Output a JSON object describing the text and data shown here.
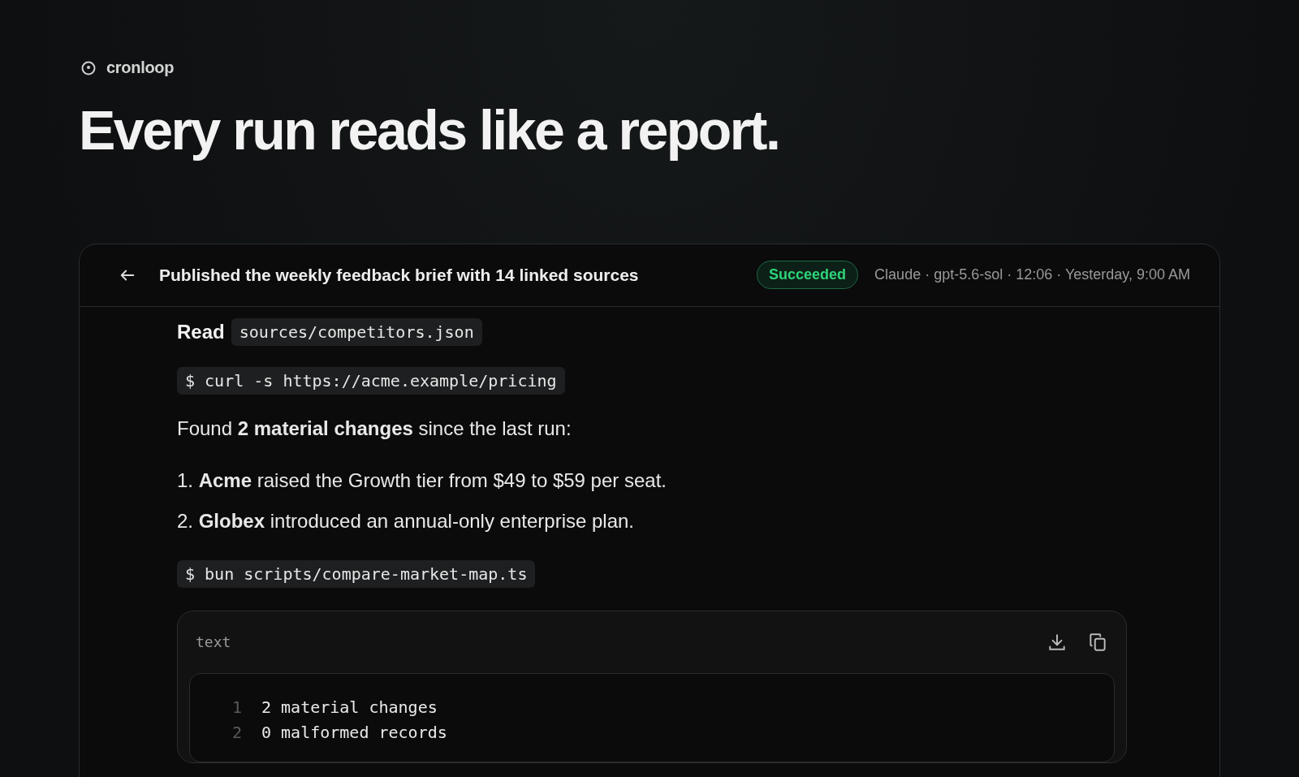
{
  "brand": {
    "name": "cronloop"
  },
  "headline": "Every run reads like a report.",
  "run": {
    "title": "Published the weekly feedback brief with 14 linked sources",
    "status": {
      "label": "Succeeded",
      "kind": "success"
    },
    "meta": "Claude · gpt-5.6-sol · 12:06 · Yesterday, 9:00 AM"
  },
  "steps": [
    {
      "kind": "read",
      "label": "Read",
      "path": "sources/competitors.json"
    },
    {
      "kind": "command",
      "text": "$ curl -s https://acme.example/pricing"
    },
    {
      "kind": "text",
      "text": "Found **2 material changes** since the last run:"
    },
    {
      "kind": "list",
      "items": [
        "1. **Acme** raised the Growth tier from $49 to $59 per seat.",
        "2. **Globex** introduced an annual-only enterprise plan."
      ]
    },
    {
      "kind": "command",
      "text": "$ bun scripts/compare-market-map.ts"
    },
    {
      "kind": "output",
      "language": "text",
      "lines": [
        {
          "number": "1",
          "text": "2 material changes"
        },
        {
          "number": "2",
          "text": "0 malformed records"
        }
      ]
    }
  ]
}
